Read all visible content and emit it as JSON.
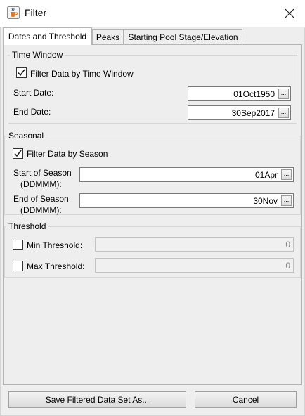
{
  "window": {
    "title": "Filter",
    "icon": "java-cup-icon"
  },
  "tabs": [
    "Dates and Threshold",
    "Peaks",
    "Starting Pool Stage/Elevation"
  ],
  "time_window": {
    "title": "Time Window",
    "checkbox_label": "Filter Data by Time Window",
    "checked": true,
    "start_label": "Start Date:",
    "start_value": "01Oct1950",
    "end_label": "End Date:",
    "end_value": "30Sep2017"
  },
  "seasonal": {
    "title": "Seasonal",
    "checkbox_label": "Filter Data by Season",
    "checked": true,
    "start_label_1": "Start of Season",
    "start_label_2": "(DDMMM):",
    "start_value": "01Apr",
    "end_label_1": "End of Season",
    "end_label_2": "(DDMMM):",
    "end_value": "30Nov"
  },
  "threshold": {
    "title": "Threshold",
    "min_label": "Min Threshold:",
    "min_value": "0",
    "max_label": "Max Threshold:",
    "max_value": "0"
  },
  "dots_label": "...",
  "buttons": {
    "save": "Save Filtered Data Set As...",
    "cancel": "Cancel"
  }
}
